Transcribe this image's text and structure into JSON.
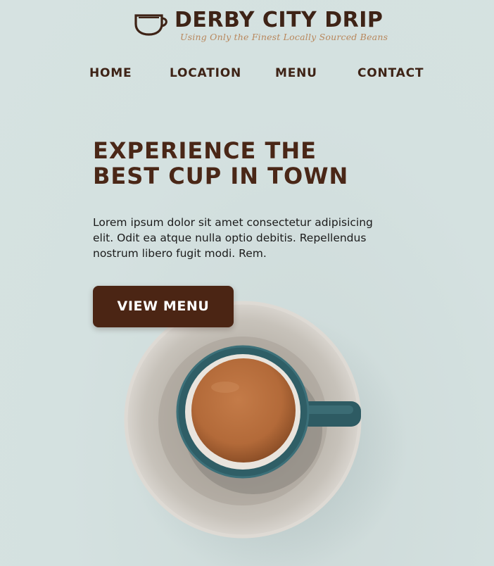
{
  "brand": {
    "name": "DERBY CITY DRIP",
    "tagline": "Using Only the Finest Locally Sourced Beans",
    "logo_icon": "coffee-cup-icon"
  },
  "nav": {
    "items": [
      {
        "label": "HOME"
      },
      {
        "label": "LOCATION"
      },
      {
        "label": "MENU"
      },
      {
        "label": "CONTACT"
      }
    ]
  },
  "hero": {
    "title": "EXPERIENCE THE BEST CUP IN TOWN",
    "body": "Lorem ipsum dolor sit amet consectetur adipisicing elit. Odit ea atque nulla optio debitis. Repellendus nostrum libero fugit modi. Rem.",
    "button_label": "VIEW MENU",
    "image": "coffee-cup-on-saucer"
  },
  "colors": {
    "background": "#d4e1e0",
    "brand_brown": "#3e2316",
    "button_brown": "#4b2514",
    "tagline_tan": "#b8875c",
    "cup_teal": "#2f5e66",
    "coffee": "#b66c3c"
  }
}
